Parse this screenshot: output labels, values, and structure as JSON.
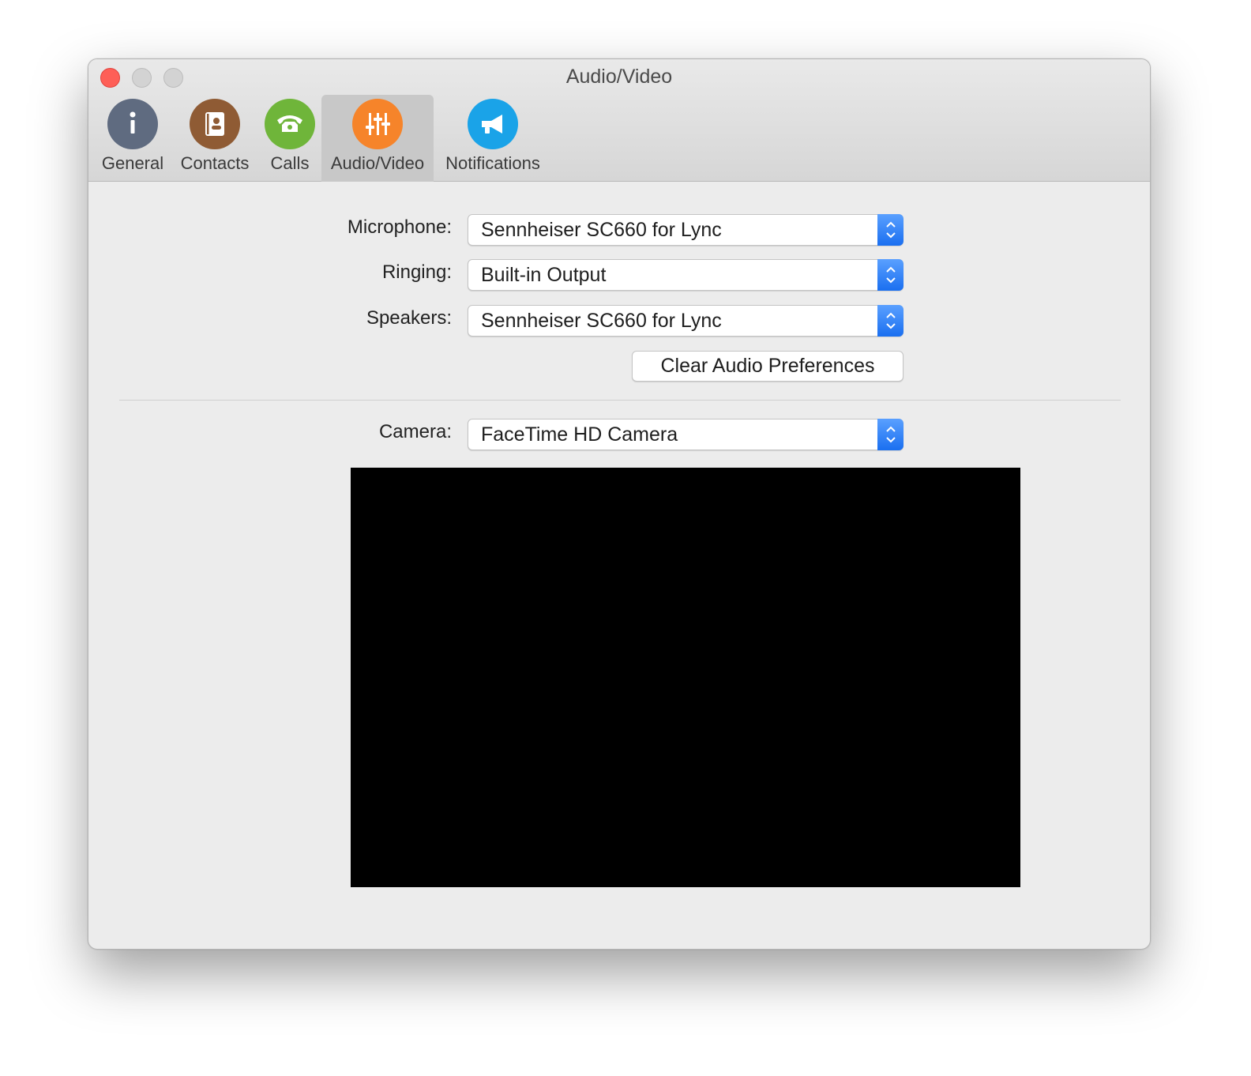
{
  "window": {
    "title": "Audio/Video"
  },
  "toolbar": {
    "tabs": [
      {
        "label": "General",
        "icon": "info-icon",
        "color": "#5f6b80"
      },
      {
        "label": "Contacts",
        "icon": "address-book-icon",
        "color": "#8f5b34"
      },
      {
        "label": "Calls",
        "icon": "telephone-icon",
        "color": "#6fb53a"
      },
      {
        "label": "Audio/Video",
        "icon": "sliders-icon",
        "color": "#f6842a",
        "active": true
      },
      {
        "label": "Notifications",
        "icon": "megaphone-icon",
        "color": "#1aa3e8"
      }
    ]
  },
  "form": {
    "microphone": {
      "label": "Microphone:",
      "value": "Sennheiser SC660 for Lync"
    },
    "ringing": {
      "label": "Ringing:",
      "value": "Built-in Output"
    },
    "speakers": {
      "label": "Speakers:",
      "value": "Sennheiser SC660 for Lync"
    },
    "clear_button": "Clear Audio Preferences",
    "camera": {
      "label": "Camera:",
      "value": "FaceTime HD Camera"
    }
  }
}
